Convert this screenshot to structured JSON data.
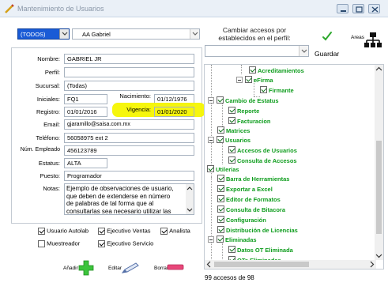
{
  "window": {
    "title": "Mantenimiento de Usuarios"
  },
  "toolbar": {
    "filter_value": "(TODOS)",
    "user_value": "AA Gabriel",
    "copy_label": "Cambiar accesos por establecidos en el perfil:",
    "copy_label_line1": "Cambiar accesos por",
    "copy_label_line2": "establecidos en el perfil:",
    "save_label": "Guardar",
    "areas_label": "Areas"
  },
  "form": {
    "labels": {
      "nombre": "Nombre:",
      "perfil": "Perfil:",
      "sucursal": "Sucursal:",
      "iniciales": "Iniciales:",
      "nacimiento": "Nacimiento:",
      "registro": "Registro:",
      "vigencia": "Vigencia:",
      "email": "Email:",
      "telefono": "Teléfono:",
      "num_empleado": "Núm. Empleado",
      "estatus": "Estatus:",
      "puesto": "Puesto:",
      "notas": "Notas:"
    },
    "values": {
      "nombre": "GABRIEL JR",
      "perfil": "",
      "sucursal": "(Todas)",
      "iniciales": "FQ1",
      "nacimiento": "01/12/1976",
      "registro": "01/01/2016",
      "vigencia": "01/01/2020",
      "email": "gjaramillo@saisa.com.mx",
      "telefono": "56058975 ext 2",
      "num_empleado": "456123789",
      "estatus": "ALTA",
      "puesto": "Programador",
      "notas_line1": "Ejemplo de observaciones de usuario,",
      "notas_line2": "que deben de extenderse en número",
      "notas_line3": "de palabras de tal forma que al",
      "notas_line4": "consultarlas sea necesario utilizar las"
    },
    "highlight_color": "#f5f500"
  },
  "checkboxes": [
    {
      "label": "Usuario Autolab",
      "checked": true
    },
    {
      "label": "Ejecutivo Ventas",
      "checked": true
    },
    {
      "label": "Analista",
      "checked": true
    },
    {
      "label": "Muestreador",
      "checked": false
    },
    {
      "label": "Ejecutivo Servicio",
      "checked": true
    }
  ],
  "actions": {
    "add_label": "Añadir",
    "edit_label": "Editar",
    "delete_label": "Borrar"
  },
  "tree": {
    "nodes": [
      {
        "label": "Acreditamientos"
      },
      {
        "label": "eFirma"
      },
      {
        "label": "Firmante"
      },
      {
        "label": "Cambio de Estatus"
      },
      {
        "label": "Reporte"
      },
      {
        "label": "Facturacion"
      },
      {
        "label": "Matrices"
      },
      {
        "label": "Usuarios"
      },
      {
        "label": "Accesos de Usuarios"
      },
      {
        "label": "Consulta de Accesos"
      },
      {
        "label": "Utilerias"
      },
      {
        "label": "Barra de Herramientas"
      },
      {
        "label": "Exportar a Excel"
      },
      {
        "label": "Editor de Formatos"
      },
      {
        "label": "Consulta de Bitacora"
      },
      {
        "label": "Configuración"
      },
      {
        "label": "Distribución de Licencias"
      },
      {
        "label": "Eliminadas"
      },
      {
        "label": "Datos OT Eliminada"
      },
      {
        "label": "OTs Eliminadas"
      }
    ],
    "status": "99 accesos de 98",
    "node_color": "#0f9d1e"
  }
}
